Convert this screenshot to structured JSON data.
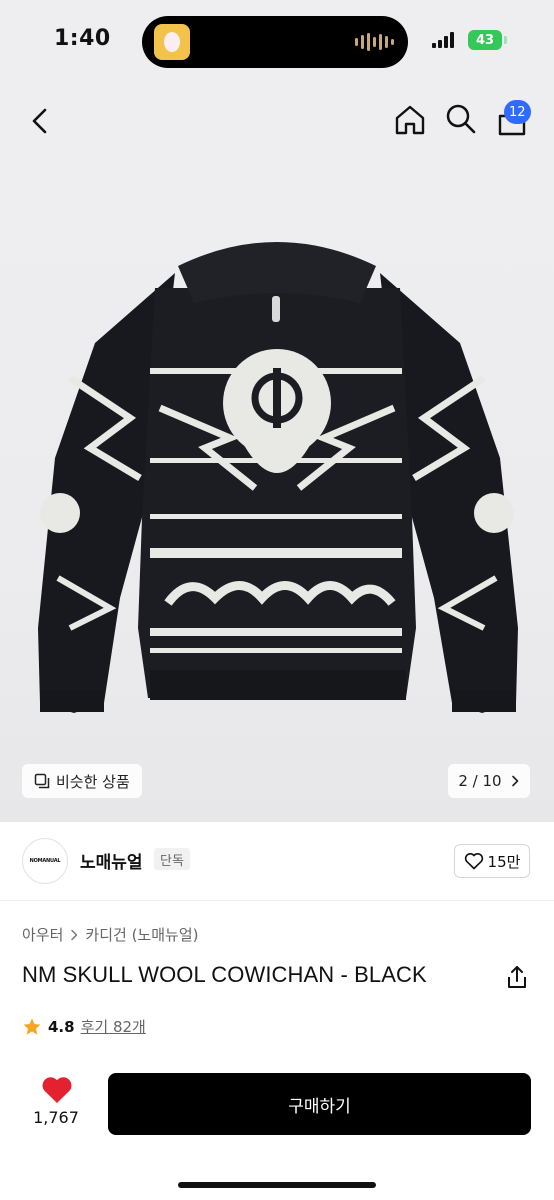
{
  "status_bar": {
    "time": "1:40",
    "battery": "43"
  },
  "header": {
    "cart_count": "12"
  },
  "gallery": {
    "similar_label": "비슷한 상품",
    "pager": "2 / 10"
  },
  "brand": {
    "logo_text": "NOMANUAL",
    "name": "노매뉴얼",
    "tag": "단독",
    "likes": "15만"
  },
  "product": {
    "breadcrumb": [
      "아우터",
      "카디건 (노매뉴얼)"
    ],
    "title": "NM SKULL WOOL COWICHAN - BLACK",
    "rating": "4.8",
    "reviews": "후기 82개",
    "wish_count": "1,767",
    "buy_label": "구매하기"
  },
  "colors": {
    "accent_blue": "#2f6bff",
    "heart_red": "#e5212f",
    "star_orange": "#f5a623",
    "buy_button": "#000000",
    "battery_green": "#34c759"
  },
  "icons": [
    "back-icon",
    "home-icon",
    "search-icon",
    "cart-icon",
    "similar-items-icon",
    "chevron-right-icon",
    "heart-outline-icon",
    "share-icon",
    "star-icon",
    "heart-filled-icon"
  ]
}
